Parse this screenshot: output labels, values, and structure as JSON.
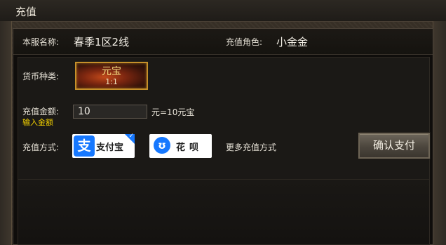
{
  "window": {
    "title": "充值"
  },
  "server": {
    "label": "本服名称:",
    "value": "春季1区2线"
  },
  "role": {
    "label": "充值角色:",
    "value": "小金金"
  },
  "currency": {
    "label": "货币种类:",
    "name": "元宝",
    "rate": "1:1"
  },
  "amount": {
    "label": "充值金额:",
    "hint": "输入金额",
    "value": "10",
    "unit": "元=10元宝"
  },
  "payment": {
    "label": "充值方式:",
    "alipay": {
      "logo": "支",
      "label": "支付宝"
    },
    "huabei": {
      "logo": "ʊ",
      "label": "花呗"
    },
    "more_label": "更多充值方式"
  },
  "confirm": {
    "label": "确认支付"
  },
  "colors": {
    "hint": "#f2d000",
    "accent_gold": "#c5902a",
    "alipay_blue": "#1678ff"
  }
}
